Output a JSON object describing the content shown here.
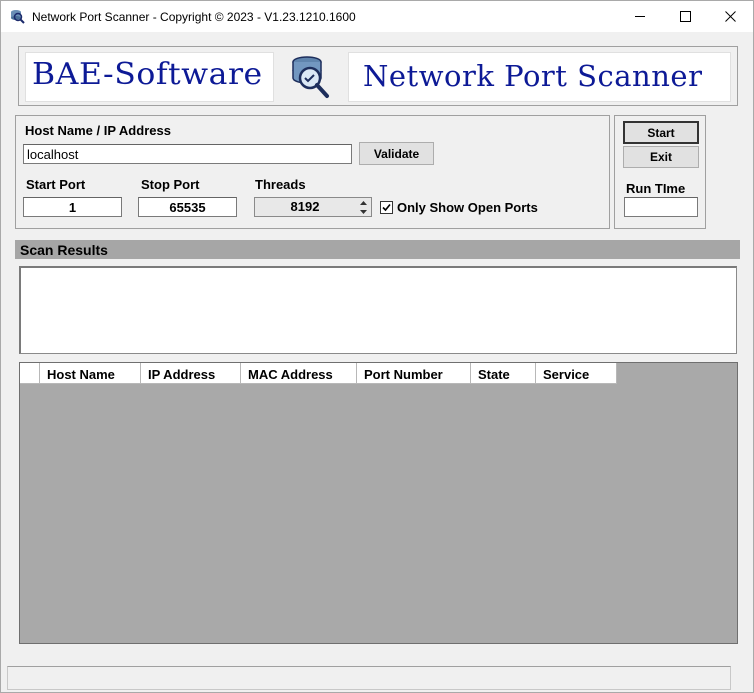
{
  "window": {
    "title": "Network Port Scanner - Copyright © 2023 - V1.23.1210.1600"
  },
  "banner": {
    "brand": "BAE-Software",
    "product": "Network Port Scanner"
  },
  "form": {
    "host_label": "Host Name / IP Address",
    "host_value": "localhost",
    "validate_label": "Validate",
    "start_port_label": "Start Port",
    "start_port_value": "1",
    "stop_port_label": "Stop Port",
    "stop_port_value": "65535",
    "threads_label": "Threads",
    "threads_value": "8192",
    "only_open_label": "Only Show Open Ports",
    "only_open_checked": true
  },
  "side": {
    "start_label": "Start",
    "exit_label": "Exit",
    "run_time_label": "Run TIme",
    "run_time_value": ""
  },
  "results": {
    "header": "Scan Results",
    "log_text": ""
  },
  "grid": {
    "columns": [
      "Host Name",
      "IP Address",
      "MAC Address",
      "Port Number",
      "State",
      "Service"
    ],
    "rows": []
  },
  "colors": {
    "banner_text": "#0d1a96",
    "section_header": "#a6a6a6",
    "grid_background": "#a9a9a9"
  },
  "icons": {
    "app": "network-scanner-icon",
    "logo": "database-magnifier-icon",
    "check": "checkmark-icon",
    "spinner_up": "up-arrow-icon",
    "spinner_down": "down-arrow-icon"
  }
}
